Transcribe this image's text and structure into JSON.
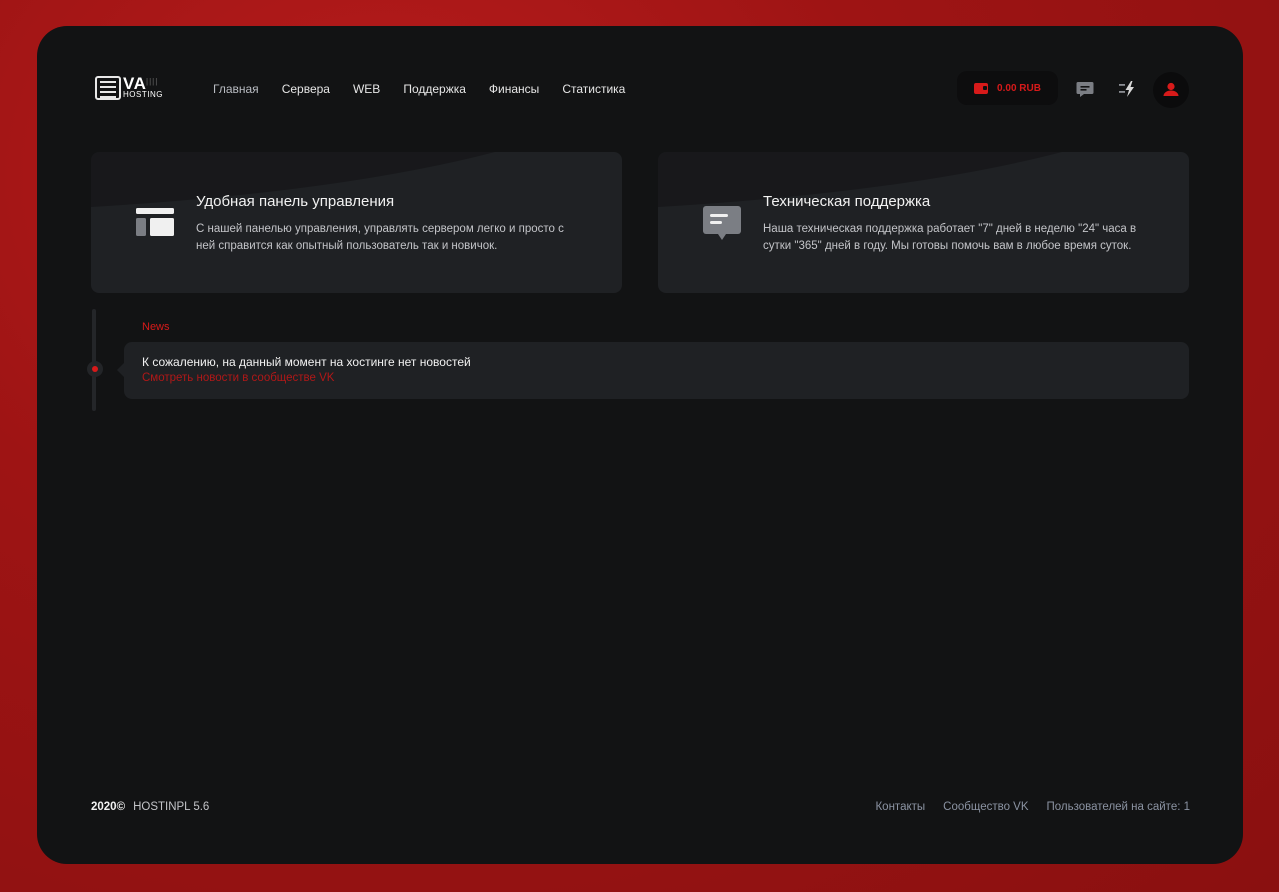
{
  "logo": {
    "main": "VA",
    "sub": "HOSTING"
  },
  "nav": [
    {
      "label": "Главная"
    },
    {
      "label": "Сервера"
    },
    {
      "label": "WEB"
    },
    {
      "label": "Поддержка"
    },
    {
      "label": "Финансы"
    },
    {
      "label": "Статистика"
    }
  ],
  "header": {
    "balance": "0.00 RUB"
  },
  "cards": [
    {
      "title": "Удобная панель управления",
      "text": "С нашей панелью управления, управлять сервером легко и просто с ней справится как опытный пользователь так и новичок."
    },
    {
      "title": "Техническая поддержка",
      "text": "Наша техническая поддержка работает \"7\" дней в неделю \"24\" часа в сутки \"365\" дней в году. Мы готовы помочь вам в любое время суток."
    }
  ],
  "news": {
    "label": "News",
    "message": "К сожалению, на данный момент на хостинге нет новостей",
    "link": "Смотреть новости в сообществе VK"
  },
  "footer": {
    "year": "2020©",
    "version": "HOSTINPL 5.6",
    "links": [
      "Контакты",
      "Сообщество VK",
      "Пользователей на сайте: 1"
    ]
  },
  "colors": {
    "accent": "#d71a1a",
    "panel": "#121314",
    "card": "#1f2124",
    "background": "#9e1414"
  }
}
